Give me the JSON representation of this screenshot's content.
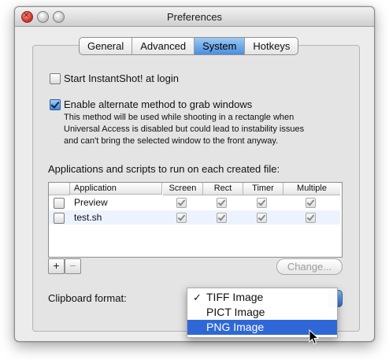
{
  "window": {
    "title": "Preferences"
  },
  "tabs": [
    "General",
    "Advanced",
    "System",
    "Hotkeys"
  ],
  "active_tab": "System",
  "options": {
    "start_at_login": {
      "label": "Start InstantShot! at login",
      "checked": false
    },
    "alt_method": {
      "label": "Enable alternate method to grab windows",
      "checked": true,
      "description_lines": [
        "This method will be used while shooting in a rectangle when",
        "Universal Access is disabled but could lead to instability issues",
        "and can't bring the selected window to the front anyway."
      ]
    }
  },
  "apps_section": {
    "heading": "Applications and scripts to run on each created file:",
    "columns": [
      "Application",
      "Screen",
      "Rect",
      "Timer",
      "Multiple"
    ],
    "rows": [
      {
        "name": "Preview",
        "enabled": false,
        "screen": true,
        "rect": true,
        "timer": true,
        "multiple": true
      },
      {
        "name": "test.sh",
        "enabled": false,
        "screen": true,
        "rect": true,
        "timer": true,
        "multiple": true
      }
    ],
    "add_label": "+",
    "remove_label": "−",
    "change_label": "Change..."
  },
  "clipboard": {
    "label": "Clipboard format:",
    "options": [
      "TIFF Image",
      "PICT Image",
      "PNG Image"
    ],
    "checked_option": "TIFF Image",
    "highlighted_option": "PNG Image",
    "checkmark": "✓"
  },
  "colors": {
    "accent": "#2f68d6",
    "selected_tab": "#4a8ee0"
  }
}
